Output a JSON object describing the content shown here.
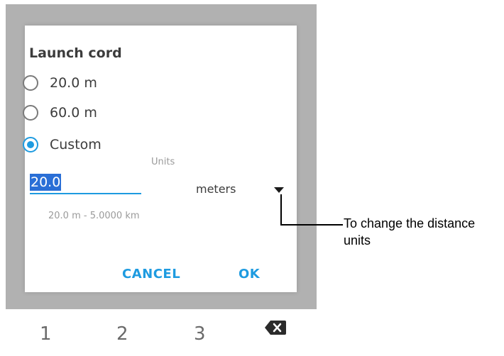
{
  "dialog": {
    "title": "Launch cord",
    "options": [
      {
        "label": "20.0 m",
        "checked": false
      },
      {
        "label": "60.0 m",
        "checked": false
      },
      {
        "label": "Custom",
        "checked": true
      }
    ],
    "units_label": "Units",
    "distance_value": "20.0",
    "unit_selected": "meters",
    "range_hint": "20.0 m - 5.0000 km",
    "cancel_label": "CANCEL",
    "ok_label": "OK"
  },
  "keyboard": {
    "keys": [
      "1",
      "2",
      "3"
    ]
  },
  "annotation": {
    "text": "To change the distance units"
  },
  "colors": {
    "accent": "#1e9be0",
    "selection": "#2a6fd6",
    "backdrop": "#b1b1b1"
  }
}
